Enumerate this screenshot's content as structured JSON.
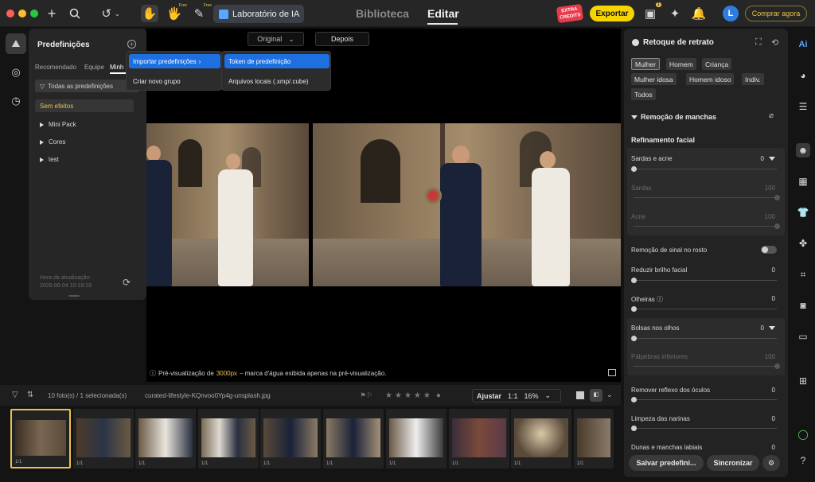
{
  "topbar": {
    "lab_label": "Laboratório de IA",
    "free_tag": "Free",
    "tab_library": "Biblioteca",
    "tab_edit": "Editar",
    "extra_credits": "EXTRA CREDITS",
    "export_label": "Exportar",
    "notif_count": "1",
    "avatar_letter": "L",
    "buy_label": "Comprar agora"
  },
  "presets": {
    "title": "Predefinições",
    "tabs": [
      "Recomendado",
      "Equipe",
      "Minh"
    ],
    "filter_label": "Todas as predefinições",
    "none_label": "Sem efeitos",
    "folders": [
      "Mini Pack",
      "Cores",
      "test"
    ],
    "update_label": "Hora da atualização:",
    "update_time": "2026-06-04 10:18:29"
  },
  "menu": {
    "import": "Importar predefinições",
    "new_group": "Criar novo grupo",
    "token": "Token de predefinição",
    "local_files": "Arquivos locais (.xmp/.cube)"
  },
  "viewer": {
    "original_label": "Original",
    "after_label": "Depois",
    "note_prefix": "Pré-visualização de",
    "note_size": "3000px",
    "note_suffix": "– marca d'água exibida apenas na pré-visualização."
  },
  "filmbar": {
    "count": "10 foto(s) / 1 selecionada(s)",
    "filename": "curated-lifestyle-KQnvoo0Yp4g-unsplash.jpg",
    "fit_label": "Ajustar",
    "ratio_label": "1:1",
    "zoom": "16%"
  },
  "thumbs": [
    "1/1",
    "1/1",
    "1/1",
    "1/1",
    "1/1",
    "1/1",
    "1/1",
    "1/1",
    "1/1",
    "1/1"
  ],
  "portrait": {
    "title": "Retoque de retrato",
    "chips": [
      "Mulher",
      "Homem",
      "Criança",
      "Mulher idosa",
      "Homem idoso",
      "Indiv.",
      "Todos"
    ],
    "blemish_section": "Remoção de manchas",
    "refine_section": "Refinamento facial",
    "sliders": {
      "freckles": {
        "label": "Sardas e acne",
        "value": "0"
      },
      "sardas": {
        "label": "Sardas",
        "value": "100"
      },
      "acne": {
        "label": "Acne",
        "value": "100"
      },
      "signal": {
        "label": "Remoção de sinal no rosto"
      },
      "shine": {
        "label": "Reduzir brilho facial",
        "value": "0"
      },
      "dark_circles": {
        "label": "Olheiras",
        "value": "0"
      },
      "eye_bags": {
        "label": "Bolsas nos olhos",
        "value": "0"
      },
      "lower_lids": {
        "label": "Pálpebras inferiores",
        "value": "100"
      },
      "glasses": {
        "label": "Remover reflexo dos óculos",
        "value": "0"
      },
      "nostrils": {
        "label": "Limpeza das narinas",
        "value": "0"
      },
      "lips": {
        "label": "Dunas e manchas labiais",
        "value": "0"
      }
    },
    "save_label": "Salvar predefini...",
    "sync_label": "Sincronizar"
  },
  "colors": {
    "accent": "#e8c350",
    "highlight": "#1e6fe0",
    "export": "#f5d400"
  }
}
